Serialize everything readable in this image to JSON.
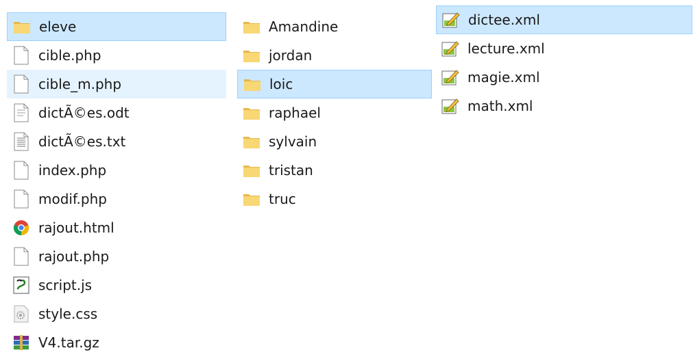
{
  "explorer": {
    "left_pane": [
      {
        "label": "eleve",
        "icon": "folder-icon",
        "state": "selected"
      },
      {
        "label": "cible.php",
        "icon": "blank-file-icon",
        "state": ""
      },
      {
        "label": "cible_m.php",
        "icon": "blank-file-icon",
        "state": "hover"
      },
      {
        "label": "dictÃ©es.odt",
        "icon": "document-file-icon",
        "state": ""
      },
      {
        "label": "dictÃ©es.txt",
        "icon": "text-file-icon",
        "state": ""
      },
      {
        "label": "index.php",
        "icon": "blank-file-icon",
        "state": ""
      },
      {
        "label": "modif.php",
        "icon": "blank-file-icon",
        "state": ""
      },
      {
        "label": "rajout.html",
        "icon": "chrome-icon",
        "state": ""
      },
      {
        "label": "rajout.php",
        "icon": "blank-file-icon",
        "state": ""
      },
      {
        "label": "script.js",
        "icon": "script-file-icon",
        "state": ""
      },
      {
        "label": "style.css",
        "icon": "gear-file-icon",
        "state": ""
      },
      {
        "label": "V4.tar.gz",
        "icon": "archive-icon",
        "state": ""
      }
    ],
    "middle_pane": [
      {
        "label": "Amandine",
        "icon": "folder-icon",
        "state": ""
      },
      {
        "label": "jordan",
        "icon": "folder-icon",
        "state": ""
      },
      {
        "label": "loic",
        "icon": "folder-icon",
        "state": "selected"
      },
      {
        "label": "raphael",
        "icon": "folder-icon",
        "state": ""
      },
      {
        "label": "sylvain",
        "icon": "folder-icon",
        "state": ""
      },
      {
        "label": "tristan",
        "icon": "folder-icon",
        "state": ""
      },
      {
        "label": "truc",
        "icon": "folder-icon",
        "state": ""
      }
    ],
    "right_pane": [
      {
        "label": "dictee.xml",
        "icon": "xml-file-icon",
        "state": "selected"
      },
      {
        "label": "lecture.xml",
        "icon": "xml-file-icon",
        "state": ""
      },
      {
        "label": "magie.xml",
        "icon": "xml-file-icon",
        "state": ""
      },
      {
        "label": "math.xml",
        "icon": "xml-file-icon",
        "state": ""
      }
    ]
  },
  "colors": {
    "selected_bg": "#cce8ff",
    "selected_border": "#99d1ff",
    "hover_bg": "#e5f3ff",
    "folder": "#f8d775"
  }
}
